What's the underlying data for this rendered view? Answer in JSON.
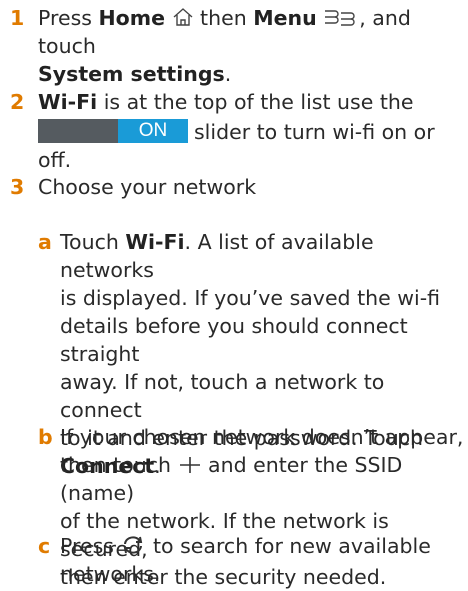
{
  "step1": {
    "number": "1",
    "t1": "Press ",
    "home": "Home",
    "t2": " then ",
    "menu": "Menu",
    "t3": ", and touch",
    "system_settings": "System settings",
    "t4": "."
  },
  "step2": {
    "number": "2",
    "wifi": "Wi-Fi",
    "t1": " is at the top of the list use the",
    "slider_label": "ON",
    "t2": "slider to turn wi-fi on or off."
  },
  "step3": {
    "number": "3",
    "text": "Choose your network",
    "a": {
      "letter": "a",
      "t1": "Touch ",
      "wifi": "Wi-Fi",
      "l1_rest": ". A list of available networks",
      "l2": "is displayed. If you’ve saved the wi-fi",
      "l3": "details before you should connect straight",
      "l4": "away. If not, touch a network to connect",
      "l5": "to it and enter the password. Touch",
      "connect": "Connect",
      "t_end": "."
    },
    "b": {
      "letter": "b",
      "l1": "If your chosen network doesn’t appear,",
      "l2a": "then touch ",
      "l2b": " and enter the SSID (name)",
      "l3": "of the network. If the network is secured,",
      "l4": "then enter the security needed."
    },
    "c": {
      "letter": "c",
      "l1a": "Press ",
      "l1b": " to search for new available",
      "l2": "networks."
    }
  },
  "colors": {
    "accent": "#e07b00",
    "slider_on": "#1a9bd7",
    "slider_track": "#555b60"
  },
  "icons": [
    "home-icon",
    "menu-icon",
    "plus-icon",
    "refresh-icon"
  ]
}
